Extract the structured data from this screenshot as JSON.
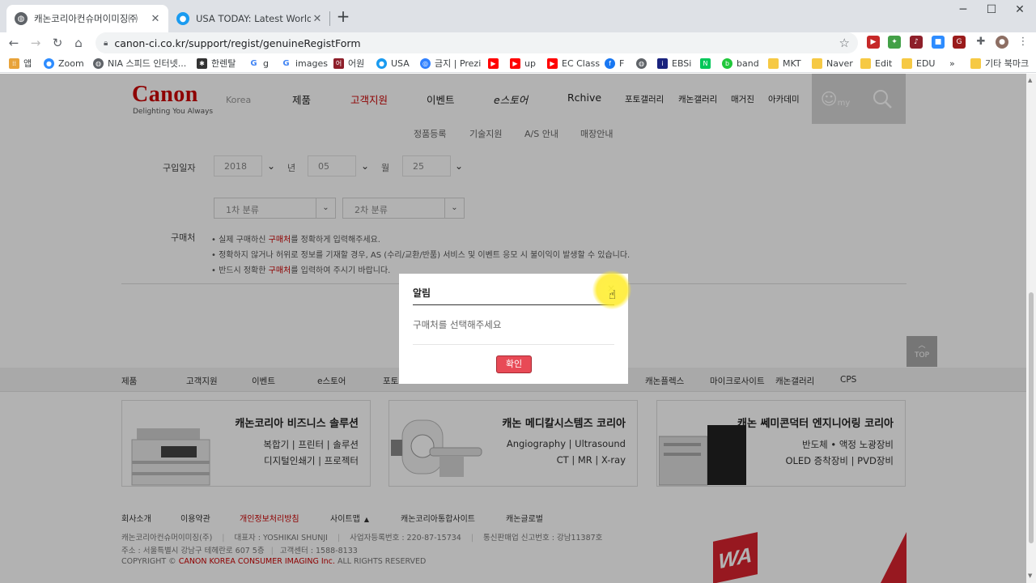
{
  "browser": {
    "tabs": [
      {
        "title": "캐논코리아컨슈머이미징㈜",
        "active": true
      },
      {
        "title": "USA TODAY: Latest World and US",
        "active": false
      }
    ],
    "url": "canon-ci.co.kr/support/regist/genuineRegistForm",
    "bookmarks": [
      {
        "label": "앱",
        "icon": "apps-grid-icon"
      },
      {
        "label": "Zoom",
        "icon": "zoom-icon"
      },
      {
        "label": "NIA 스피드 인터넷...",
        "icon": "globe-icon"
      },
      {
        "label": "한렌탈",
        "icon": "hanrental-icon"
      },
      {
        "label": "g",
        "icon": "google-icon"
      },
      {
        "label": "images",
        "icon": "google-icon"
      },
      {
        "label": "어원",
        "icon": "bookmark-icon"
      },
      {
        "label": "USA",
        "icon": "usa-icon"
      },
      {
        "label": "금지 | Prezi",
        "icon": "prezi-icon"
      },
      {
        "label": "",
        "icon": "youtube-icon"
      },
      {
        "label": "up",
        "icon": "youtube-icon"
      },
      {
        "label": "EC Class",
        "icon": "youtube-icon"
      },
      {
        "label": "F",
        "icon": "facebook-icon"
      },
      {
        "label": "",
        "icon": "globe-icon"
      },
      {
        "label": "EBSi",
        "icon": "ebsi-icon"
      },
      {
        "label": "",
        "icon": "naver-icon"
      },
      {
        "label": "band",
        "icon": "band-icon"
      },
      {
        "label": "MKT",
        "icon": "folder-icon"
      },
      {
        "label": "Naver",
        "icon": "folder-icon"
      },
      {
        "label": "Edit",
        "icon": "folder-icon"
      },
      {
        "label": "EDU",
        "icon": "folder-icon"
      }
    ],
    "more_bookmarks_label": "»",
    "other_bookmarks_label": "기타 북마크"
  },
  "site": {
    "logo": "Canon",
    "logo_tagline": "Delighting You Always",
    "logo_region": "Korea",
    "gnb": [
      "제품",
      "고객지원",
      "이벤트",
      "e스토어",
      "Rchive"
    ],
    "gnb_active": "고객지원",
    "gnb_small": [
      "포토갤러리",
      "캐논갤러리",
      "매거진",
      "아카데미"
    ],
    "my_label": "my",
    "subnav": [
      "정품등록",
      "기술지원",
      "A/S 안내",
      "매장안내"
    ]
  },
  "form": {
    "date_label": "구입일자",
    "year": "2018",
    "year_unit": "년",
    "month": "05",
    "month_unit": "월",
    "day": "25",
    "category1": "1차 분류",
    "category2": "2차 분류",
    "store_label": "구매처",
    "notes": [
      {
        "pre": "• 실제 구매하신 ",
        "red": "구매처",
        "post": "를 정확하게 입력해주세요."
      },
      {
        "pre": "• 정확하지 않거나 허위로 정보를 기재할 경우, AS (수리/교환/반품) 서비스 및 이벤트 응모 시 불이익이 발생할 수 있습니다.",
        "red": "",
        "post": ""
      },
      {
        "pre": "• 반드시 정확한 ",
        "red": "구매처",
        "post": "를 입력하여 주시기 바랍니다."
      }
    ]
  },
  "top_button": "TOP",
  "footer_nav": [
    "제품",
    "고객지원",
    "이벤트",
    "e스토어",
    "포토",
    "캐논플렉스",
    "마이크로사이트",
    "캐논갤러리",
    "CPS"
  ],
  "banners": [
    {
      "title": "캐논코리아 비즈니스 솔루션",
      "line1": "복합기 | 프린터 | 솔루션",
      "line2": "디지털인쇄기 | 프로젝터"
    },
    {
      "title": "캐논 메디칼시스템즈 코리아",
      "line1": "Angiography | Ultrasound",
      "line2": "CT | MR | X-ray"
    },
    {
      "title": "캐논 쎄미콘덕터 엔지니어링 코리아",
      "line1": "반도체 • 액정 노광장비",
      "line2": "OLED 증착장비 | PVD장비"
    }
  ],
  "footer_links": {
    "company": "회사소개",
    "terms": "이용약관",
    "privacy": "개인정보처리방침",
    "sitemap": "사이트맵",
    "integrated": "캐논코리아통합사이트",
    "global": "캐논글로벌"
  },
  "footer_info": {
    "company_name": "캐논코리아컨슈머이미징(주)",
    "ceo": "대표자 : YOSHIKAI SHUNJI",
    "biz_no": "사업자등록번호 : 220-87-15734",
    "ecom_no": "통신판매업 신고번호 : 강남11387호",
    "address": "주소 : 서울특별시 강남구 테헤란로 607 5층",
    "cs": "고객센터 : 1588-8133",
    "copyright_pre": "COPYRIGHT © ",
    "copyright_red": "CANON KOREA CONSUMER IMAGING Inc.",
    "copyright_post": " ALL RIGHTS RESERVED"
  },
  "wa_logo": "WA",
  "modal": {
    "title": "알림",
    "close": "×",
    "message": "구매처를 선택해주세요",
    "ok": "확인"
  },
  "colors": {
    "brand": "#cc0000",
    "ok_button": "#e84a56"
  }
}
